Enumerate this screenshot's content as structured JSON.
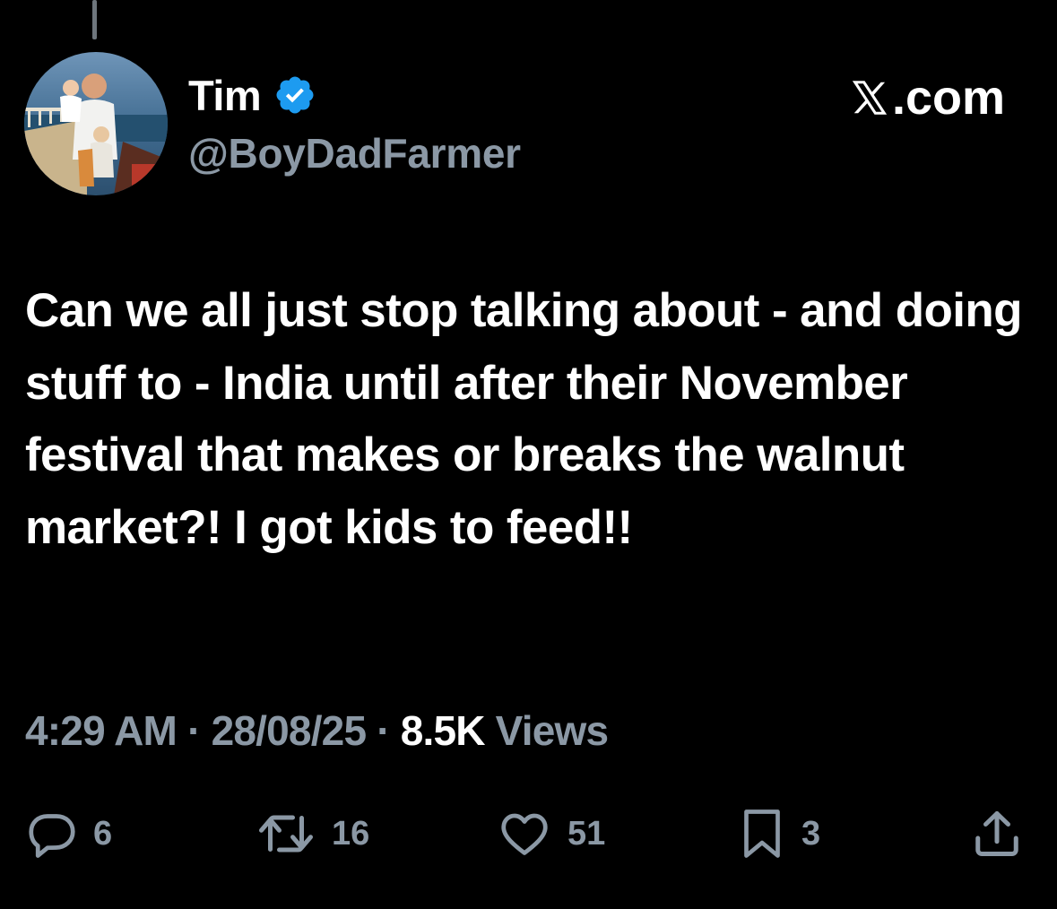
{
  "author": {
    "display_name": "Tim",
    "handle": "@BoyDadFarmer",
    "verified": true,
    "verified_color": "#1d9bf0"
  },
  "brand": {
    "label": ".com",
    "icon": "x-logo-icon"
  },
  "tweet": {
    "text": "Can we all just stop talking about - and doing stuff to - India until after their November festival that makes or breaks the walnut market?! I got kids to feed!!",
    "time": "4:29 AM",
    "separator": " · ",
    "date": "28/08/25",
    "views_count": "8.5K",
    "views_label": " Views"
  },
  "actions": {
    "replies": {
      "icon": "reply-icon",
      "count": "6"
    },
    "reposts": {
      "icon": "repost-icon",
      "count": "16"
    },
    "likes": {
      "icon": "heart-icon",
      "count": "51"
    },
    "bookmarks": {
      "icon": "bookmark-icon",
      "count": "3"
    },
    "share": {
      "icon": "share-icon"
    }
  },
  "colors": {
    "background": "#000000",
    "text_primary": "#ffffff",
    "text_secondary": "#8b98a5"
  }
}
